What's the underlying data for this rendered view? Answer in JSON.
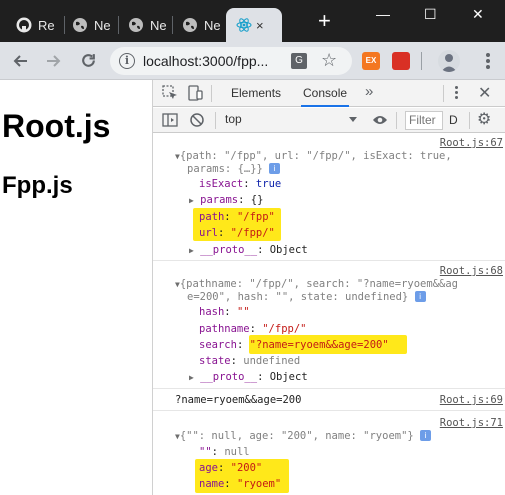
{
  "browser": {
    "tabs": [
      {
        "label": "Re",
        "icon": "github-icon"
      },
      {
        "label": "Ne",
        "icon": "globe-icon"
      },
      {
        "label": "Ne",
        "icon": "globe-icon"
      },
      {
        "label": "Ne",
        "icon": "globe-icon"
      },
      {
        "label": "×",
        "icon": "react-icon",
        "active": true
      }
    ],
    "new_tab_label": "+",
    "window_controls": {
      "minimize": "—",
      "maximize": "☐",
      "close": "✕"
    },
    "omnibox": {
      "url": "localhost:3000/fpp..."
    },
    "extensions": [
      {
        "label": "EX",
        "color": "#f47721"
      },
      {
        "label": "",
        "color": "#d93025"
      }
    ]
  },
  "page": {
    "heading": "Root.js",
    "subheading": "Fpp.js"
  },
  "devtools": {
    "tabs": {
      "elements": "Elements",
      "console": "Console",
      "more": "»"
    },
    "filterbar": {
      "context": "top",
      "filter_placeholder": "Filter",
      "levels": "D"
    },
    "messages": [
      {
        "source": "Root.js:67",
        "summary_l1": "{path: \"/fpp\", url: \"/fpp/\", isExact: true,",
        "summary_l2": "params: {…}}",
        "props": [
          {
            "key": "isExact",
            "value": "true"
          },
          {
            "key": "params",
            "value": "{}"
          },
          {
            "key": "path",
            "value": "\"/fpp\""
          },
          {
            "key": "url",
            "value": "\"/fpp/\""
          },
          {
            "key": "__proto__",
            "value": "Object"
          }
        ]
      },
      {
        "source": "Root.js:68",
        "summary_l1": "{pathname: \"/fpp/\", search: \"?name=ryoem&&ag",
        "summary_l2": "e=200\", hash: \"\", state: undefined}",
        "props": [
          {
            "key": "hash",
            "value": "\"\""
          },
          {
            "key": "pathname",
            "value": "\"/fpp/\""
          },
          {
            "key": "search",
            "value": "\"?name=ryoem&&age=200\""
          },
          {
            "key": "state",
            "value": "undefined"
          },
          {
            "key": "__proto__",
            "value": "Object"
          }
        ]
      },
      {
        "source": "Root.js:69",
        "text": "?name=ryoem&&age=200"
      },
      {
        "source": "Root.js:71",
        "summary_l1": "{\"\": null, age: \"200\", name: \"ryoem\"}",
        "props": [
          {
            "key": "\"\"",
            "value": "null"
          },
          {
            "key": "age",
            "value": "\"200\""
          },
          {
            "key": "name",
            "value": "\"ryoem\""
          }
        ]
      }
    ]
  },
  "colors": {
    "highlight": "#ffe81a",
    "tabstrip": "#1f1f1f",
    "toolbar": "#dee1e6",
    "active_tab_underline": "#1a73e8"
  }
}
